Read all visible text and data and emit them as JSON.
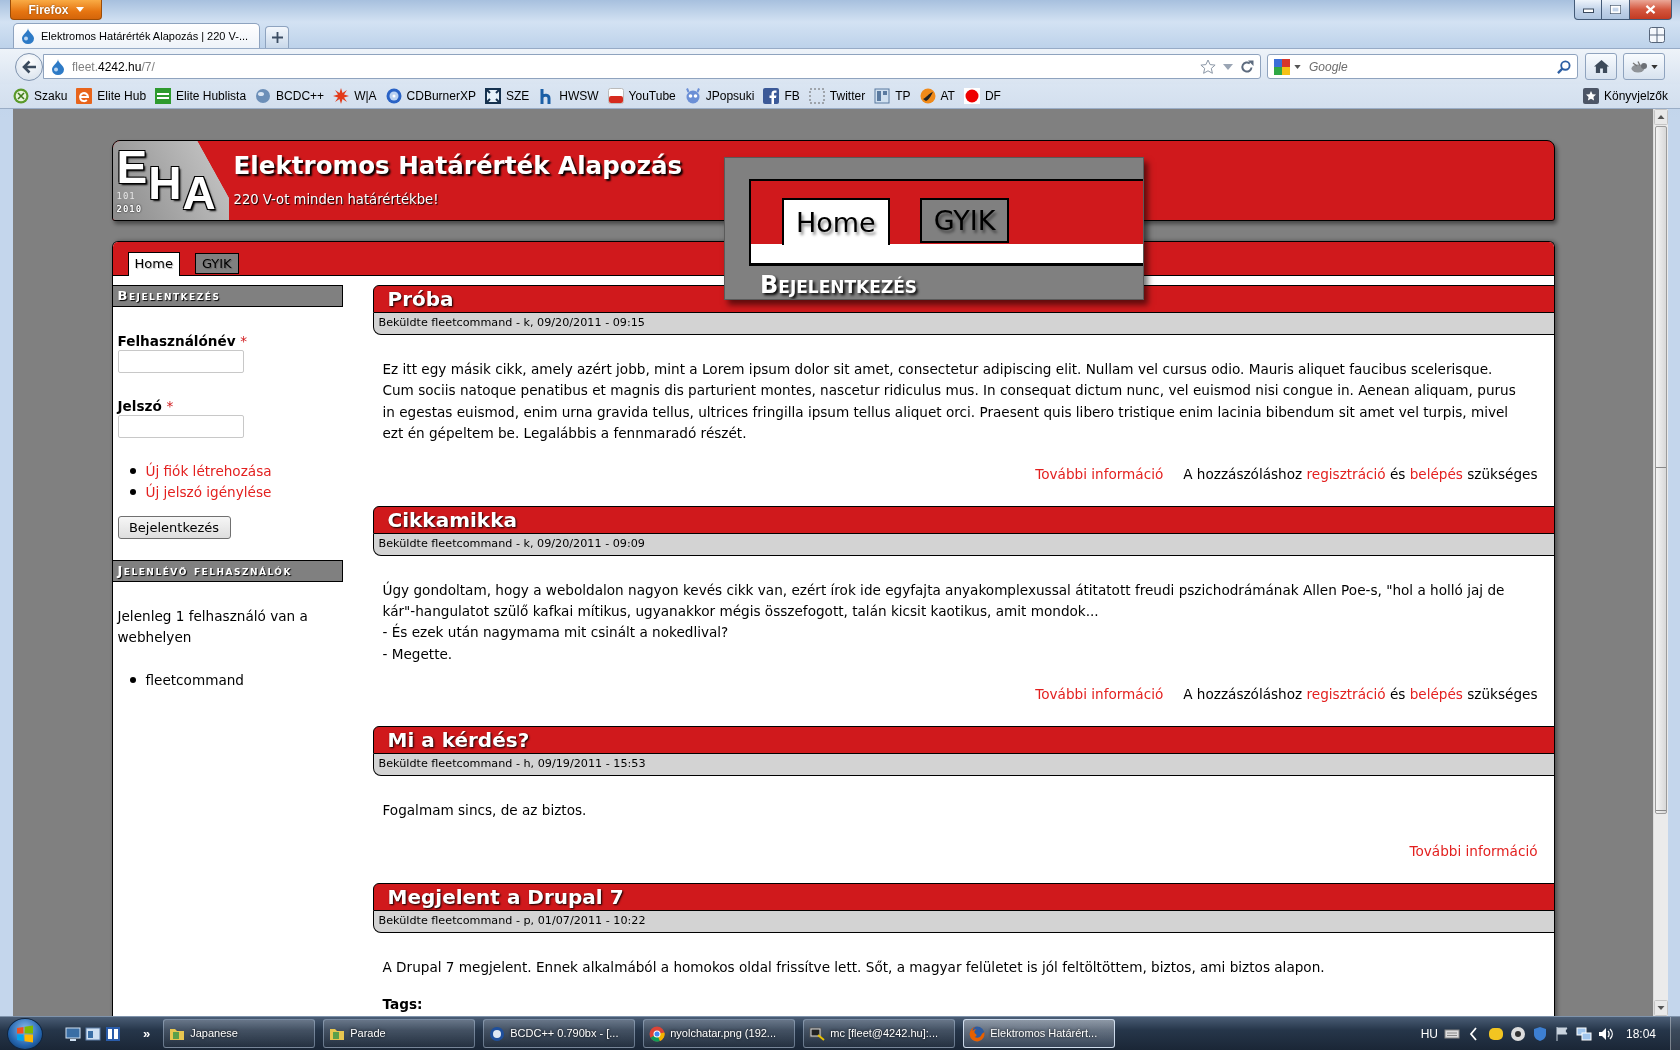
{
  "browser": {
    "menu_button": "Firefox",
    "tabs": [
      {
        "title": "Elektromos Határérték Alapozás | 220 V-...",
        "selected": true
      }
    ],
    "address": {
      "prefix": "fleet.",
      "domain": "4242.hu",
      "path": "/7/"
    },
    "search": {
      "placeholder": "Google"
    },
    "bookmarks": [
      "Szaku",
      "Elite Hub",
      "Elite Hublista",
      "BCDC++",
      "W|A",
      "CDBurnerXP",
      "SZE",
      "HWSW",
      "YouTube",
      "JPopsuki",
      "FB",
      "Twitter",
      "TP",
      "AT",
      "DF"
    ],
    "bookmarks_menu": "Könyvjelzők"
  },
  "page": {
    "logo": {
      "letters": [
        "E",
        "H",
        "A"
      ],
      "digits": [
        "101",
        "2010"
      ]
    },
    "site_name": "Elektromos Határérték Alapozás",
    "slogan": "220 V-ot minden határértékbe!",
    "nav": [
      {
        "label": "Home",
        "selected": true
      },
      {
        "label": "GYIK",
        "selected": false
      }
    ],
    "sidebar": [
      {
        "kind": "login",
        "title": "Bejelentkezés",
        "fields": [
          {
            "label": "Felhasználónév",
            "required_mark": "*"
          },
          {
            "label": "Jelszó",
            "required_mark": "*"
          }
        ],
        "links": [
          "Új fiók létrehozása",
          "Új jelszó igénylése"
        ],
        "button": "Bejelentkezés"
      },
      {
        "kind": "online",
        "title": "Jelenlévő felhasználók",
        "text": "Jelenleg 1 felhasználó van a webhelyen",
        "users": [
          "fleetcommand"
        ]
      }
    ],
    "articles": [
      {
        "title": "Próba",
        "meta": "Beküldte fleetcommand - k, 09/20/2011 - 09:15",
        "body": [
          "Ez itt egy másik cikk, amely azért jobb, mint a Lorem ipsum dolor sit amet, consectetur adipiscing elit. Nullam vel cursus odio. Mauris aliquet faucibus scelerisque. Cum sociis natoque penatibus et magnis dis parturient montes, nascetur ridiculus mus. In consequat dictum nunc, vel euismod nisi congue in. Aenean aliquam, purus in egestas euismod, enim urna gravida tellus, ultrices fringilla ipsum tellus aliquet orci. Praesent quis libero tristique enim lacinia bibendum sit amet vel turpis, mivel ezt én gépeltem be. Legalábbis a fennmaradó részét."
        ],
        "read_more": "További információ",
        "comment_notice": [
          {
            "text": "A hozzászóláshoz",
            "link": false
          },
          {
            "text": "regisztráció",
            "link": true
          },
          {
            "text": "és",
            "link": false
          },
          {
            "text": "belépés",
            "link": true
          },
          {
            "text": "szükséges",
            "link": false
          }
        ]
      },
      {
        "title": "Cikkamikka",
        "meta": "Beküldte fleetcommand - k, 09/20/2011 - 09:09",
        "body": [
          "Úgy gondoltam, hogy a weboldalon nagyon kevés cikk van, ezért írok ide egyfajta anyakomplexussal átitatott freudi pszichodrámának Allen Poe-s, \"hol a holló jaj de kár\"-hangulatot szülő kafkai mítikus, ugyanakkor mégis összefogott, talán kicsit kaotikus, amit mondok...",
          "- És ezek után nagymama mit csinált a nokedlival?",
          "- Megette."
        ],
        "read_more": "További információ",
        "comment_notice": [
          {
            "text": "A hozzászóláshoz",
            "link": false
          },
          {
            "text": "regisztráció",
            "link": true
          },
          {
            "text": "és",
            "link": false
          },
          {
            "text": "belépés",
            "link": true
          },
          {
            "text": "szükséges",
            "link": false
          }
        ]
      },
      {
        "title": "Mi a kérdés?",
        "meta": "Beküldte fleetcommand - h, 09/19/2011 - 15:53",
        "body": [
          "Fogalmam sincs, de az biztos."
        ],
        "read_more": "További információ"
      },
      {
        "title": "Megjelent a Drupal 7",
        "meta": "Beküldte fleetcommand - p, 01/07/2011 - 10:22",
        "body": [
          "A Drupal 7 megjelent. Ennek alkalmából a homokos oldal frissítve lett. Sőt, a magyar felületet is jól feltöltöttem, biztos, ami biztos alapon."
        ],
        "tags_label": "Tags:"
      }
    ]
  },
  "zoom_inset": {
    "tabs": [
      {
        "label": "Home",
        "selected": true
      },
      {
        "label": "GYIK",
        "selected": false
      }
    ],
    "block_title": "Bejelentkezés"
  },
  "taskbar": {
    "quick_launch_more": "»",
    "buttons": [
      {
        "label": "Japanese",
        "selected": false
      },
      {
        "label": "Parade",
        "selected": false
      },
      {
        "label": "BCDC++ 0.790bx - [...",
        "selected": false
      },
      {
        "label": "nyolchatar.png (192...",
        "selected": false
      },
      {
        "label": "mc [fleet@4242.hu]:...",
        "selected": false
      },
      {
        "label": "Elektromos Határért...",
        "selected": true
      }
    ],
    "language": "HU",
    "clock": "18:04"
  }
}
